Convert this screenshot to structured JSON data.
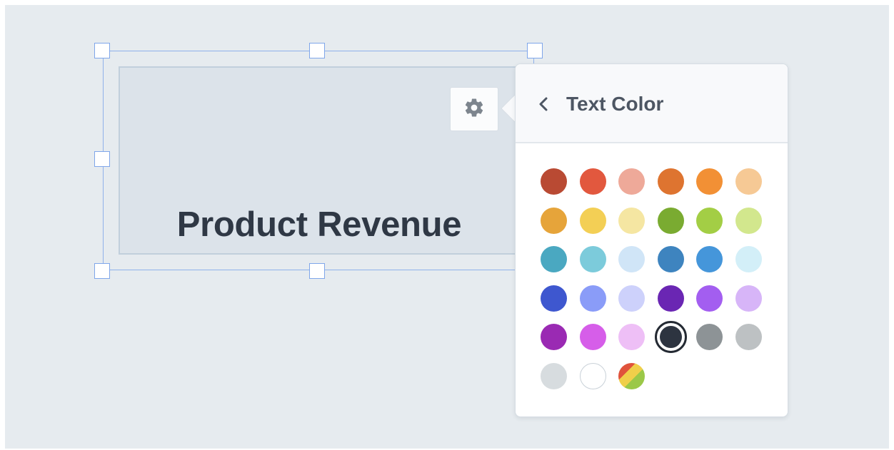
{
  "widget": {
    "title": "Product Revenue"
  },
  "settings_button": {
    "icon": "gear-icon"
  },
  "popover": {
    "title": "Text Color",
    "back_icon": "chevron-left-icon"
  },
  "colors": [
    {
      "hex": "#b94a33",
      "selected": false
    },
    {
      "hex": "#e2583e",
      "selected": false
    },
    {
      "hex": "#eea999",
      "selected": false
    },
    {
      "hex": "#de7430",
      "selected": false
    },
    {
      "hex": "#f29035",
      "selected": false
    },
    {
      "hex": "#f6c995",
      "selected": false
    },
    {
      "hex": "#e6a43a",
      "selected": false
    },
    {
      "hex": "#f3cf55",
      "selected": false
    },
    {
      "hex": "#f5e6a2",
      "selected": false
    },
    {
      "hex": "#7aab31",
      "selected": false
    },
    {
      "hex": "#a3ce45",
      "selected": false
    },
    {
      "hex": "#d2e78d",
      "selected": false
    },
    {
      "hex": "#4aa8c1",
      "selected": false
    },
    {
      "hex": "#7ccbdb",
      "selected": false
    },
    {
      "hex": "#d0e5f7",
      "selected": false
    },
    {
      "hex": "#3e84bf",
      "selected": false
    },
    {
      "hex": "#4596da",
      "selected": false
    },
    {
      "hex": "#d3eff8",
      "selected": false
    },
    {
      "hex": "#3e57cf",
      "selected": false
    },
    {
      "hex": "#8a9cf8",
      "selected": false
    },
    {
      "hex": "#cdd1fb",
      "selected": false
    },
    {
      "hex": "#6a26b3",
      "selected": false
    },
    {
      "hex": "#a35ef0",
      "selected": false
    },
    {
      "hex": "#d7b5f8",
      "selected": false
    },
    {
      "hex": "#9a2ab3",
      "selected": false
    },
    {
      "hex": "#d65ee9",
      "selected": false
    },
    {
      "hex": "#eebff6",
      "selected": false
    },
    {
      "hex": "#2d3440",
      "selected": true
    },
    {
      "hex": "#8d9396",
      "selected": false
    },
    {
      "hex": "#bdc1c3",
      "selected": false
    },
    {
      "hex": "#d7dcdf",
      "selected": false
    },
    {
      "hex": "#ffffff",
      "selected": false
    },
    {
      "hex": "custom-gradient",
      "selected": false
    }
  ]
}
